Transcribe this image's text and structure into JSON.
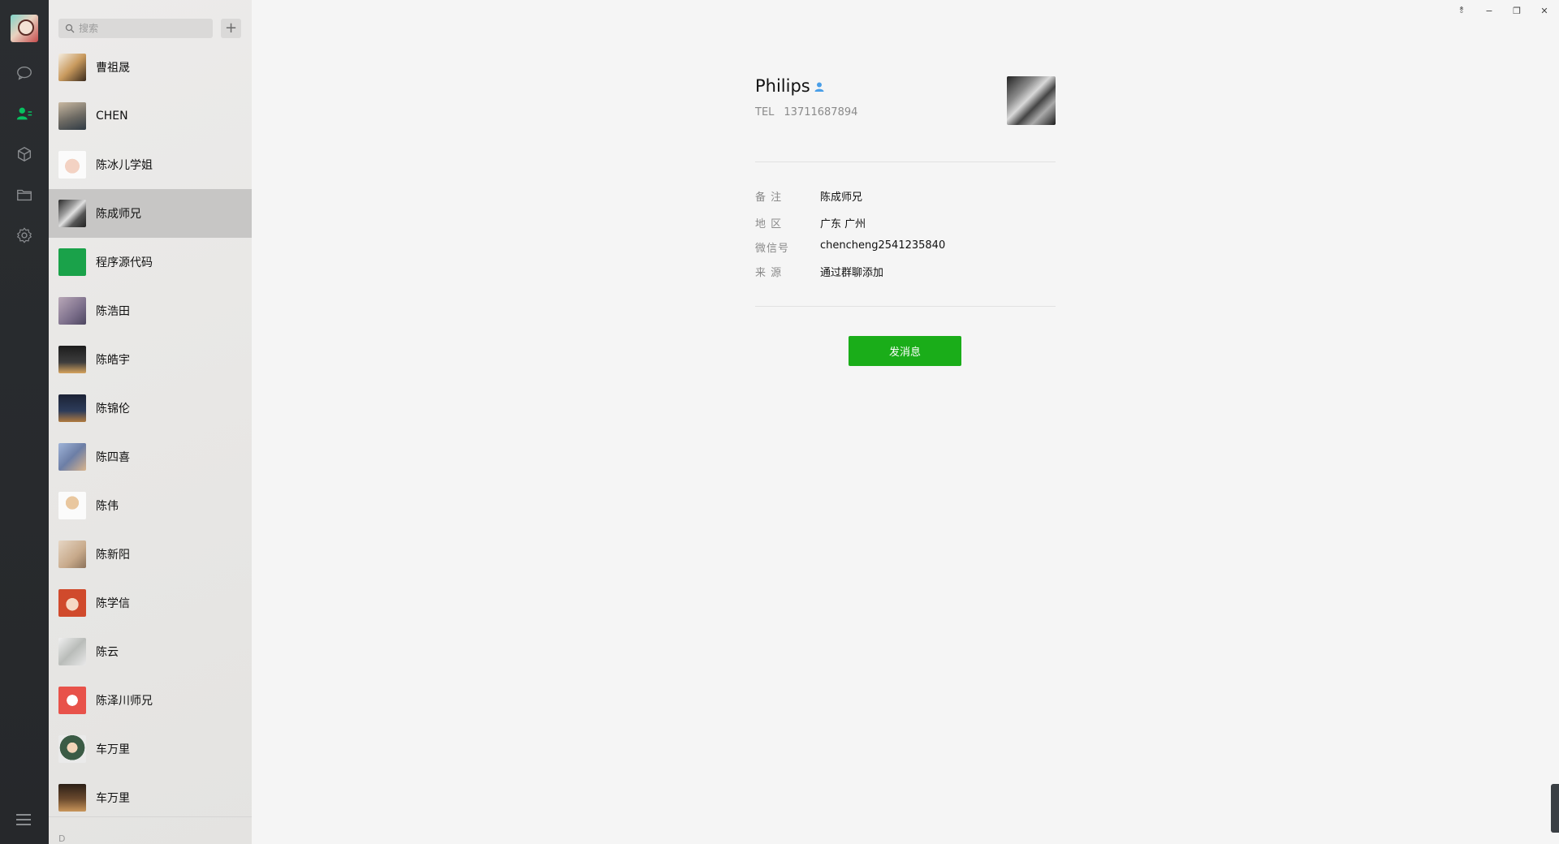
{
  "nav": {
    "icons": [
      "chat-icon",
      "contacts-icon",
      "cube-icon",
      "folder-icon",
      "settings-icon",
      "menu-icon"
    ]
  },
  "search": {
    "placeholder": "搜索",
    "add_label": "+"
  },
  "contacts": [
    {
      "name": "曹祖晟"
    },
    {
      "name": "CHEN"
    },
    {
      "name": "陈冰儿学姐"
    },
    {
      "name": "陈成师兄"
    },
    {
      "name": "程序源代码"
    },
    {
      "name": "陈浩田"
    },
    {
      "name": "陈皓宇"
    },
    {
      "name": "陈锦伦"
    },
    {
      "name": "陈四喜"
    },
    {
      "name": "陈伟"
    },
    {
      "name": "陈新阳"
    },
    {
      "name": "陈学信"
    },
    {
      "name": "陈云"
    },
    {
      "name": "陈泽川师兄"
    },
    {
      "name": "车万里"
    },
    {
      "name": "车万里"
    }
  ],
  "next_section_letter": "D",
  "window": {
    "pin": "⥉",
    "minimize": "−",
    "restore": "❐",
    "close": "✕"
  },
  "detail": {
    "name": "Philips",
    "tel_label": "TEL",
    "tel": "13711687894",
    "rows": [
      {
        "label": "备 注",
        "value": "陈成师兄"
      },
      {
        "label": "地 区",
        "value": "广东 广州"
      },
      {
        "label": "微信号",
        "value": "chencheng2541235840"
      },
      {
        "label": "来 源",
        "value": "通过群聊添加"
      }
    ],
    "send_label": "发消息"
  },
  "colors": {
    "accent": "#1aad19",
    "nav_bg": "#2a2d30",
    "active_row": "#c7c6c5"
  }
}
